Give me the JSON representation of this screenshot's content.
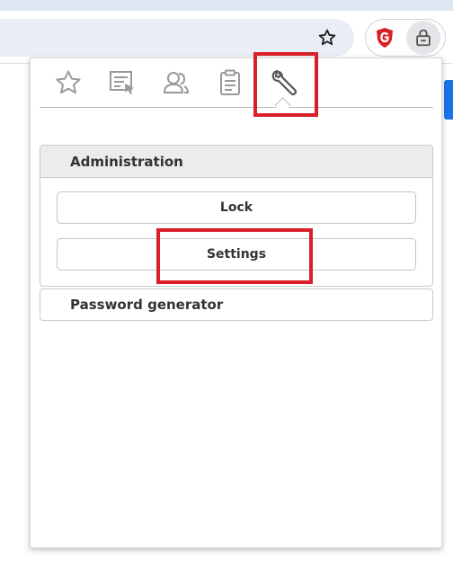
{
  "browser": {
    "bookmark_icon": "star-outline-icon",
    "extensions": [
      {
        "name": "G DATA",
        "icon": "gdata-shield-icon",
        "color": "#d9202a"
      },
      {
        "name": "Password manager",
        "icon": "padlock-icon",
        "active": true
      }
    ]
  },
  "popup": {
    "tabs": [
      {
        "name": "Favorites",
        "icon": "star-icon",
        "selected": false
      },
      {
        "name": "Logins",
        "icon": "form-list-icon",
        "selected": false
      },
      {
        "name": "Identities",
        "icon": "contacts-icon",
        "selected": false
      },
      {
        "name": "Notes",
        "icon": "clipboard-icon",
        "selected": false
      },
      {
        "name": "Tools",
        "icon": "wrench-icon",
        "selected": true
      }
    ],
    "administration": {
      "title": "Administration",
      "lock_label": "Lock",
      "settings_label": "Settings"
    },
    "password_generator": {
      "title": "Password generator"
    }
  },
  "colors": {
    "highlight": "#d9202a",
    "browser_accent": "#1a73e8",
    "icon_gray": "#9a9a9a"
  }
}
